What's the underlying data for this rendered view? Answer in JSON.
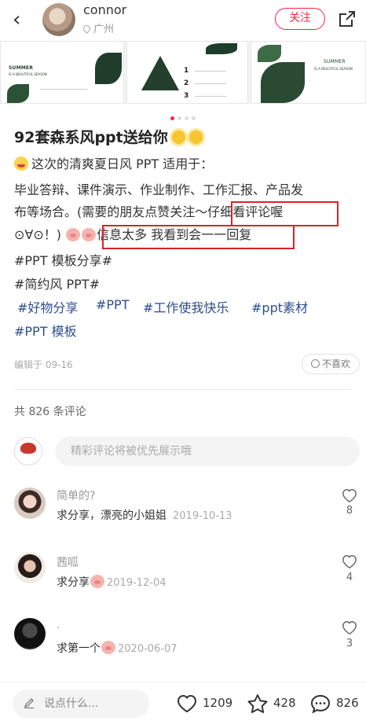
{
  "header": {
    "author": "connor",
    "location": "广州",
    "follow_label": "关注"
  },
  "post": {
    "title": "92套森系风ppt送给你",
    "line1": "这次的清爽夏日风 PPT 适用于：",
    "line2": "毕业答辩、课件演示、作业制作、工作汇报、产品发",
    "line3": "布等场合。(需要的朋友点赞关注～仔细看评论喔",
    "line4a": "⊙∀⊙！)",
    "line4b": "信息太多 我看到会一一回复",
    "tags_line1": "#PPT 模板分享#",
    "tags_line2": "#简约风 PPT#",
    "tags_line3": [
      "#好物分享",
      "#PPT",
      "#工作使我快乐",
      "#ppt素材"
    ],
    "tags_line4": "#PPT 模板",
    "edited": "编辑于 09-16",
    "dislike_label": "不喜欢"
  },
  "carousel": {
    "slide1_title": "SUMMER",
    "slide1_sub": "IS A BEAUTIFUL SEASON",
    "slide2_nums": [
      "1",
      "2",
      "3"
    ],
    "slide3_title": "SUMMER",
    "slide3_sub": "IS A BEAUTIFUL SEASON"
  },
  "comments_section": {
    "count_label": "共 826 条评论",
    "input_placeholder": "精彩评论将被优先展示哦",
    "items": [
      {
        "name": "简单的?",
        "text": "求分享，漂亮的小姐姐",
        "date": "2019-10-13",
        "likes": "8"
      },
      {
        "name": "茜呱",
        "text": "求分享",
        "date": "2019-12-04",
        "likes": "4"
      },
      {
        "name": ".",
        "text": "求第一个",
        "date": "2020-06-07",
        "likes": "3"
      }
    ]
  },
  "bottom_bar": {
    "input_placeholder": "说点什么...",
    "likes": "1209",
    "stars": "428",
    "comments": "826"
  },
  "colors": {
    "accent": "#ff2442",
    "tag": "#2e4e8c",
    "highlight_box": "#d8232a"
  }
}
